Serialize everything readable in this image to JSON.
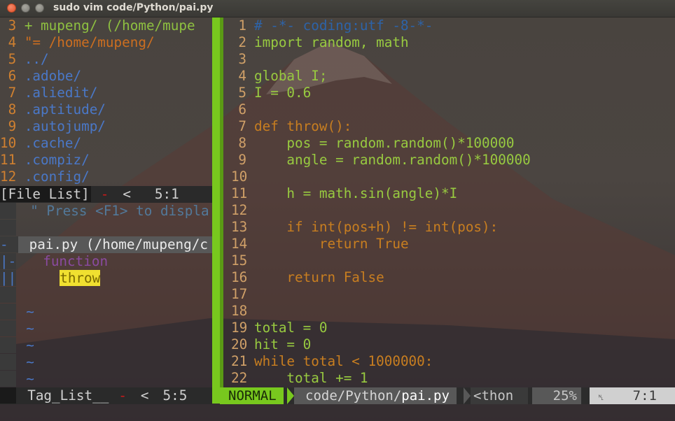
{
  "window": {
    "title": "sudo vim code/Python/pai.py"
  },
  "file_list": {
    "lines": [
      {
        "n": " 3",
        "text": " + mupeng/ (/home/mupe"
      },
      {
        "n": " 4",
        "text": " \"= /home/mupeng/"
      },
      {
        "n": " 5",
        "text": " ../"
      },
      {
        "n": " 6",
        "text": " .adobe/"
      },
      {
        "n": " 7",
        "text": " .aliedit/"
      },
      {
        "n": " 8",
        "text": " .aptitude/"
      },
      {
        "n": " 9",
        "text": " .autojump/"
      },
      {
        "n": "10",
        "text": " .cache/"
      },
      {
        "n": "11",
        "text": " .compiz/"
      },
      {
        "n": "12",
        "text": " .config/"
      }
    ],
    "status": {
      "name": "[File List]",
      "flag": "-",
      "sep": "<",
      "pos": "5:1"
    }
  },
  "tag_list": {
    "hint": "\" Press <F1> to displa",
    "file": "pai.py (/home/mupeng/c",
    "fold1": "-",
    "fold2": "|-",
    "fold3": "||",
    "kind": "function",
    "tag": "throw",
    "tilde": "~",
    "status": {
      "name": "Tag_List__",
      "flag": "-",
      "sep": "<",
      "pos": "5:5"
    }
  },
  "code": {
    "lines": [
      {
        "n": "1",
        "t": "# -*- coding:utf -8-*-"
      },
      {
        "n": "2",
        "t": "import random, math"
      },
      {
        "n": "3",
        "t": ""
      },
      {
        "n": "4",
        "t": "global I;"
      },
      {
        "n": "5",
        "t": "I = 0.6"
      },
      {
        "n": "6",
        "t": ""
      },
      {
        "n": "7",
        "t": "def throw():"
      },
      {
        "n": "8",
        "t": "    pos = random.random()*100000"
      },
      {
        "n": "9",
        "t": "    angle = random.random()*100000"
      },
      {
        "n": "10",
        "t": ""
      },
      {
        "n": "11",
        "t": "    h = math.sin(angle)*I"
      },
      {
        "n": "12",
        "t": ""
      },
      {
        "n": "13",
        "t": "    if int(pos+h) != int(pos):"
      },
      {
        "n": "14",
        "t": "        return True"
      },
      {
        "n": "15",
        "t": ""
      },
      {
        "n": "16",
        "t": "    return False"
      },
      {
        "n": "17",
        "t": ""
      },
      {
        "n": "18",
        "t": ""
      },
      {
        "n": "19",
        "t": "total = 0"
      },
      {
        "n": "20",
        "t": "hit = 0"
      },
      {
        "n": "21",
        "t": "while total < 1000000:"
      },
      {
        "n": "22",
        "t": "    total += 1"
      }
    ]
  },
  "statusline": {
    "mode": "NORMAL",
    "path": "code/Python/",
    "file": "pai.py",
    "filetype": "<thon",
    "percent": "25%",
    "ln_icon": "␤",
    "position": "7:1"
  },
  "colors": {
    "accent": "#78c81e",
    "number": "#c91a1a",
    "keyword": "#c87e20",
    "function": "#2e9dc4",
    "comment": "#2d63a8",
    "dir": "#4a78c8"
  }
}
